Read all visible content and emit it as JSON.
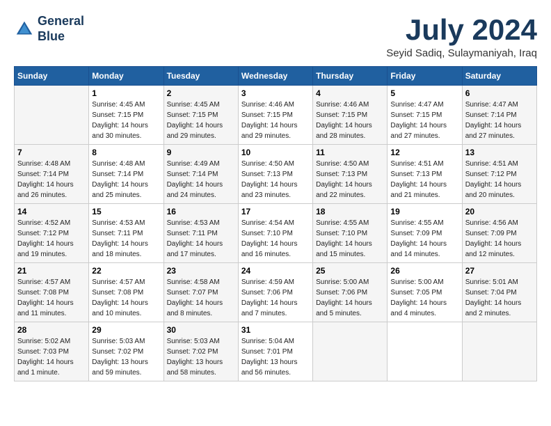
{
  "header": {
    "logo_line1": "General",
    "logo_line2": "Blue",
    "month_title": "July 2024",
    "location": "Seyid Sadiq, Sulaymaniyah, Iraq"
  },
  "days_of_week": [
    "Sunday",
    "Monday",
    "Tuesday",
    "Wednesday",
    "Thursday",
    "Friday",
    "Saturday"
  ],
  "weeks": [
    [
      {
        "day": "",
        "info": ""
      },
      {
        "day": "1",
        "info": "Sunrise: 4:45 AM\nSunset: 7:15 PM\nDaylight: 14 hours\nand 30 minutes."
      },
      {
        "day": "2",
        "info": "Sunrise: 4:45 AM\nSunset: 7:15 PM\nDaylight: 14 hours\nand 29 minutes."
      },
      {
        "day": "3",
        "info": "Sunrise: 4:46 AM\nSunset: 7:15 PM\nDaylight: 14 hours\nand 29 minutes."
      },
      {
        "day": "4",
        "info": "Sunrise: 4:46 AM\nSunset: 7:15 PM\nDaylight: 14 hours\nand 28 minutes."
      },
      {
        "day": "5",
        "info": "Sunrise: 4:47 AM\nSunset: 7:15 PM\nDaylight: 14 hours\nand 27 minutes."
      },
      {
        "day": "6",
        "info": "Sunrise: 4:47 AM\nSunset: 7:14 PM\nDaylight: 14 hours\nand 27 minutes."
      }
    ],
    [
      {
        "day": "7",
        "info": "Sunrise: 4:48 AM\nSunset: 7:14 PM\nDaylight: 14 hours\nand 26 minutes."
      },
      {
        "day": "8",
        "info": "Sunrise: 4:48 AM\nSunset: 7:14 PM\nDaylight: 14 hours\nand 25 minutes."
      },
      {
        "day": "9",
        "info": "Sunrise: 4:49 AM\nSunset: 7:14 PM\nDaylight: 14 hours\nand 24 minutes."
      },
      {
        "day": "10",
        "info": "Sunrise: 4:50 AM\nSunset: 7:13 PM\nDaylight: 14 hours\nand 23 minutes."
      },
      {
        "day": "11",
        "info": "Sunrise: 4:50 AM\nSunset: 7:13 PM\nDaylight: 14 hours\nand 22 minutes."
      },
      {
        "day": "12",
        "info": "Sunrise: 4:51 AM\nSunset: 7:13 PM\nDaylight: 14 hours\nand 21 minutes."
      },
      {
        "day": "13",
        "info": "Sunrise: 4:51 AM\nSunset: 7:12 PM\nDaylight: 14 hours\nand 20 minutes."
      }
    ],
    [
      {
        "day": "14",
        "info": "Sunrise: 4:52 AM\nSunset: 7:12 PM\nDaylight: 14 hours\nand 19 minutes."
      },
      {
        "day": "15",
        "info": "Sunrise: 4:53 AM\nSunset: 7:11 PM\nDaylight: 14 hours\nand 18 minutes."
      },
      {
        "day": "16",
        "info": "Sunrise: 4:53 AM\nSunset: 7:11 PM\nDaylight: 14 hours\nand 17 minutes."
      },
      {
        "day": "17",
        "info": "Sunrise: 4:54 AM\nSunset: 7:10 PM\nDaylight: 14 hours\nand 16 minutes."
      },
      {
        "day": "18",
        "info": "Sunrise: 4:55 AM\nSunset: 7:10 PM\nDaylight: 14 hours\nand 15 minutes."
      },
      {
        "day": "19",
        "info": "Sunrise: 4:55 AM\nSunset: 7:09 PM\nDaylight: 14 hours\nand 14 minutes."
      },
      {
        "day": "20",
        "info": "Sunrise: 4:56 AM\nSunset: 7:09 PM\nDaylight: 14 hours\nand 12 minutes."
      }
    ],
    [
      {
        "day": "21",
        "info": "Sunrise: 4:57 AM\nSunset: 7:08 PM\nDaylight: 14 hours\nand 11 minutes."
      },
      {
        "day": "22",
        "info": "Sunrise: 4:57 AM\nSunset: 7:08 PM\nDaylight: 14 hours\nand 10 minutes."
      },
      {
        "day": "23",
        "info": "Sunrise: 4:58 AM\nSunset: 7:07 PM\nDaylight: 14 hours\nand 8 minutes."
      },
      {
        "day": "24",
        "info": "Sunrise: 4:59 AM\nSunset: 7:06 PM\nDaylight: 14 hours\nand 7 minutes."
      },
      {
        "day": "25",
        "info": "Sunrise: 5:00 AM\nSunset: 7:06 PM\nDaylight: 14 hours\nand 5 minutes."
      },
      {
        "day": "26",
        "info": "Sunrise: 5:00 AM\nSunset: 7:05 PM\nDaylight: 14 hours\nand 4 minutes."
      },
      {
        "day": "27",
        "info": "Sunrise: 5:01 AM\nSunset: 7:04 PM\nDaylight: 14 hours\nand 2 minutes."
      }
    ],
    [
      {
        "day": "28",
        "info": "Sunrise: 5:02 AM\nSunset: 7:03 PM\nDaylight: 14 hours\nand 1 minute."
      },
      {
        "day": "29",
        "info": "Sunrise: 5:03 AM\nSunset: 7:02 PM\nDaylight: 13 hours\nand 59 minutes."
      },
      {
        "day": "30",
        "info": "Sunrise: 5:03 AM\nSunset: 7:02 PM\nDaylight: 13 hours\nand 58 minutes."
      },
      {
        "day": "31",
        "info": "Sunrise: 5:04 AM\nSunset: 7:01 PM\nDaylight: 13 hours\nand 56 minutes."
      },
      {
        "day": "",
        "info": ""
      },
      {
        "day": "",
        "info": ""
      },
      {
        "day": "",
        "info": ""
      }
    ]
  ]
}
